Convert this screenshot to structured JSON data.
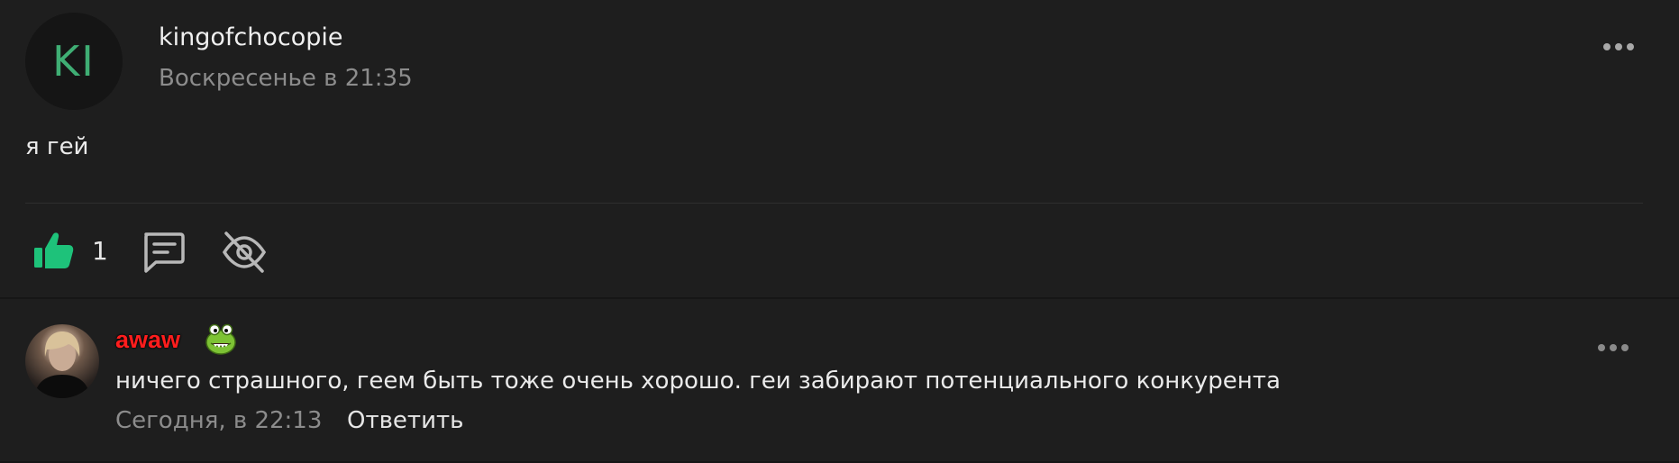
{
  "post": {
    "avatar_initials": "KI",
    "author": "kingofchocopie",
    "time": "Воскресенье в 21:35",
    "text": "я гей",
    "like_count": "1",
    "colors": {
      "accent": "#1ec27a",
      "avatar_text": "#3fae74"
    },
    "icons": [
      "more-horizontal-icon",
      "thumbs-up-icon",
      "comment-icon",
      "eye-off-icon"
    ]
  },
  "comment": {
    "author": "awaw",
    "text": "ничего страшного, геем быть тоже очень хорошо. геи забирают потенциального конкурента",
    "time": "Сегодня, в 22:13",
    "reply_label": "Ответить",
    "colors": {
      "author": "#ff1d1d"
    },
    "icons": [
      "green-monster-badge-icon",
      "more-horizontal-icon"
    ]
  }
}
